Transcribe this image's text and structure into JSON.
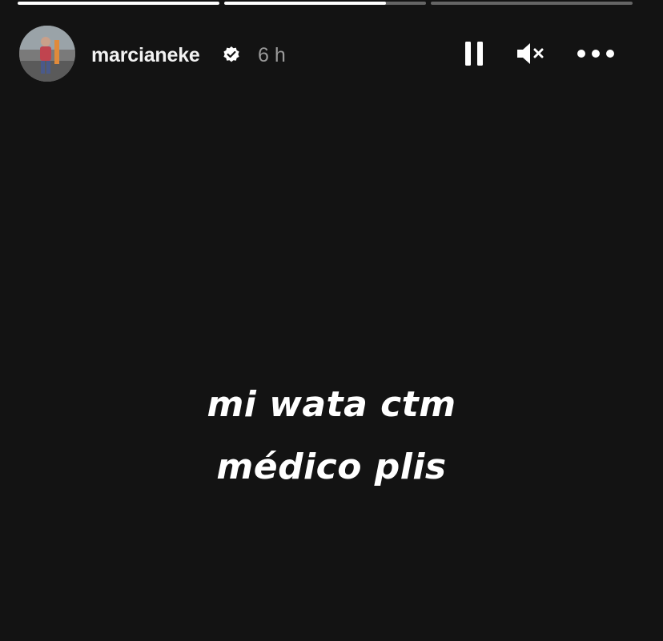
{
  "story": {
    "progress": {
      "segments": [
        {
          "fill": 1.0
        },
        {
          "fill": 0.8
        },
        {
          "fill": 0.0
        }
      ]
    },
    "header": {
      "username": "marcianeke",
      "verified": true,
      "timestamp": "6 h",
      "controls": {
        "pause_icon": "pause-icon",
        "mute_icon": "muted-speaker-icon",
        "more_icon": "more-options-icon"
      }
    },
    "caption": {
      "line1": "mi wata ctm",
      "line2": "médico plis"
    }
  },
  "colors": {
    "background": "#131313",
    "text": "#ffffff",
    "muted_text": "#9a9a9a"
  }
}
